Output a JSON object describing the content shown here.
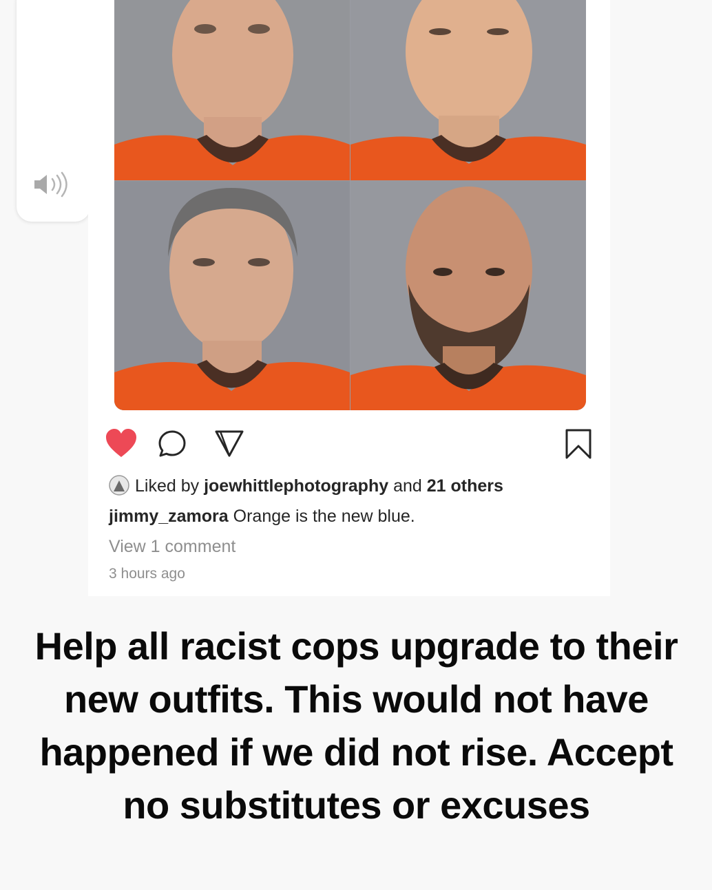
{
  "post": {
    "liked_by_prefix": "Liked by",
    "liked_by_user": "joewhittlephotography",
    "liked_by_and": "and",
    "liked_by_others": "21 others",
    "caption_user": "jimmy_zamora",
    "caption_text": "Orange is the new blue.",
    "view_comments": "View 1 comment",
    "timestamp": "3 hours ago"
  },
  "story": {
    "text": "Help all racist cops upgrade to their new outfits. This would not have happened if we did not rise. Accept no substitutes or excuses"
  },
  "icons": {
    "volume": "speaker-volume-icon",
    "like": "heart-icon",
    "comment": "comment-icon",
    "share": "paper-plane-icon",
    "save": "bookmark-icon"
  },
  "colors": {
    "like_red": "#ed4956",
    "jumpsuit_orange": "#e8571e",
    "backdrop_gray": "#9a9ca3"
  }
}
